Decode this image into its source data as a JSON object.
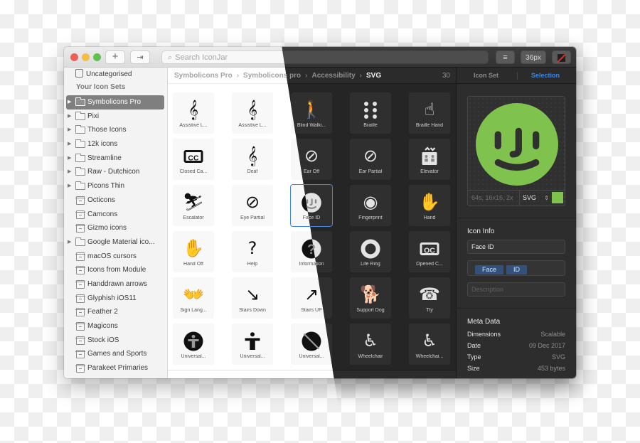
{
  "window": {
    "traffic_lights": [
      "close",
      "minimize",
      "zoom"
    ],
    "toolbar": {
      "add_label": "+",
      "export_icon": "export-icon",
      "search_placeholder": "Search IconJar",
      "search_icon": "magnifier-icon",
      "filter_icon": "filter-lines-icon",
      "size_label": "36px",
      "color_icon": "no-color-swatch-icon"
    }
  },
  "sidebar": {
    "uncategorised_label": "Uncategorised",
    "section_heading": "Your Icon Sets",
    "items": [
      {
        "label": "Symbolicons Pro",
        "type": "folder",
        "expandable": true,
        "active": true
      },
      {
        "label": "Pixi",
        "type": "folder",
        "expandable": true
      },
      {
        "label": "Those Icons",
        "type": "folder",
        "expandable": true
      },
      {
        "label": "12k icons",
        "type": "folder",
        "expandable": true
      },
      {
        "label": "Streamline",
        "type": "folder",
        "expandable": true
      },
      {
        "label": "Raw - Dutchicon",
        "type": "folder",
        "expandable": true
      },
      {
        "label": "Picons Thin",
        "type": "folder",
        "expandable": true
      },
      {
        "label": "Octicons",
        "type": "set"
      },
      {
        "label": "Camcons",
        "type": "set"
      },
      {
        "label": "Gizmo icons",
        "type": "set"
      },
      {
        "label": "Google Material ico...",
        "type": "folder",
        "expandable": true
      },
      {
        "label": "macOS cursors",
        "type": "set"
      },
      {
        "label": "Icons from Module",
        "type": "set"
      },
      {
        "label": "Handdrawn arrows",
        "type": "set"
      },
      {
        "label": "Glyphish iOS11",
        "type": "set"
      },
      {
        "label": "Feather 2",
        "type": "set"
      },
      {
        "label": "Magicons",
        "type": "set"
      },
      {
        "label": "Stock iOS",
        "type": "set"
      },
      {
        "label": "Games and Sports",
        "type": "set"
      },
      {
        "label": "Parakeet Primaries",
        "type": "set"
      }
    ]
  },
  "main": {
    "breadcrumb": [
      "Symbolicons Pro",
      "Symbolicons pro",
      "Accessibility",
      "SVG"
    ],
    "breadcrumb_separator": "›",
    "count": "30",
    "icons": [
      {
        "label": "Assistive L...",
        "glyph": "assistive-listening-icon"
      },
      {
        "label": "Assistive L...",
        "glyph": "assistive-listening-t-icon"
      },
      {
        "label": "Blind Walki...",
        "glyph": "blind-walking-icon"
      },
      {
        "label": "Braille",
        "glyph": "braille-icon"
      },
      {
        "label": "Braille Hand",
        "glyph": "braille-hand-icon"
      },
      {
        "label": "Closed Ca...",
        "glyph": "closed-captions-icon"
      },
      {
        "label": "Deaf",
        "glyph": "deaf-icon"
      },
      {
        "label": "Ear Off",
        "glyph": "ear-off-icon"
      },
      {
        "label": "Ear Partial",
        "glyph": "ear-partial-icon"
      },
      {
        "label": "Elevator",
        "glyph": "elevator-icon"
      },
      {
        "label": "Escalator",
        "glyph": "escalator-icon"
      },
      {
        "label": "Eye Partial",
        "glyph": "eye-partial-icon"
      },
      {
        "label": "Face ID",
        "glyph": "face-id-icon",
        "selected": true
      },
      {
        "label": "Fingerprint",
        "glyph": "fingerprint-icon"
      },
      {
        "label": "Hand",
        "glyph": "hand-icon"
      },
      {
        "label": "Hand Off",
        "glyph": "hand-off-icon"
      },
      {
        "label": "Help",
        "glyph": "help-icon"
      },
      {
        "label": "Information",
        "glyph": "information-icon"
      },
      {
        "label": "Life Ring",
        "glyph": "life-ring-icon"
      },
      {
        "label": "Opened C...",
        "glyph": "opened-captions-icon"
      },
      {
        "label": "Sign Lang...",
        "glyph": "sign-language-icon"
      },
      {
        "label": "Stairs Down",
        "glyph": "stairs-down-icon"
      },
      {
        "label": "Stairs UP",
        "glyph": "stairs-up-icon"
      },
      {
        "label": "Support Dog",
        "glyph": "support-dog-icon"
      },
      {
        "label": "Tty",
        "glyph": "tty-icon"
      },
      {
        "label": "Universal...",
        "glyph": "universal-access-circle-icon"
      },
      {
        "label": "Universal...",
        "glyph": "universal-access-icon"
      },
      {
        "label": "Universal...",
        "glyph": "universal-access-off-icon"
      },
      {
        "label": "Wheelchair",
        "glyph": "wheelchair-active-icon"
      },
      {
        "label": "Wheelchai...",
        "glyph": "wheelchair-icon"
      }
    ]
  },
  "inspector": {
    "tabs": [
      {
        "label": "Icon Set",
        "active": false
      },
      {
        "label": "Selection",
        "active": true
      }
    ],
    "preview": {
      "glyph": "face-id-icon",
      "color": "#7fc24e",
      "sizes_placeholder": "64s, 16x16, 2x",
      "format": "SVG"
    },
    "icon_info": {
      "title": "Icon Info",
      "name": "Face ID",
      "tags": [
        "Face",
        "ID"
      ],
      "description_placeholder": "Description"
    },
    "meta": {
      "title": "Meta Data",
      "rows": [
        {
          "key": "Dimensions",
          "value": "Scalable"
        },
        {
          "key": "Date",
          "value": "09 Dec 2017"
        },
        {
          "key": "Type",
          "value": "SVG"
        },
        {
          "key": "Size",
          "value": "453 bytes"
        }
      ]
    }
  },
  "colors": {
    "accent": "#3d86e6",
    "preview_green": "#7fc24e",
    "tag_bg": "#34517e"
  }
}
